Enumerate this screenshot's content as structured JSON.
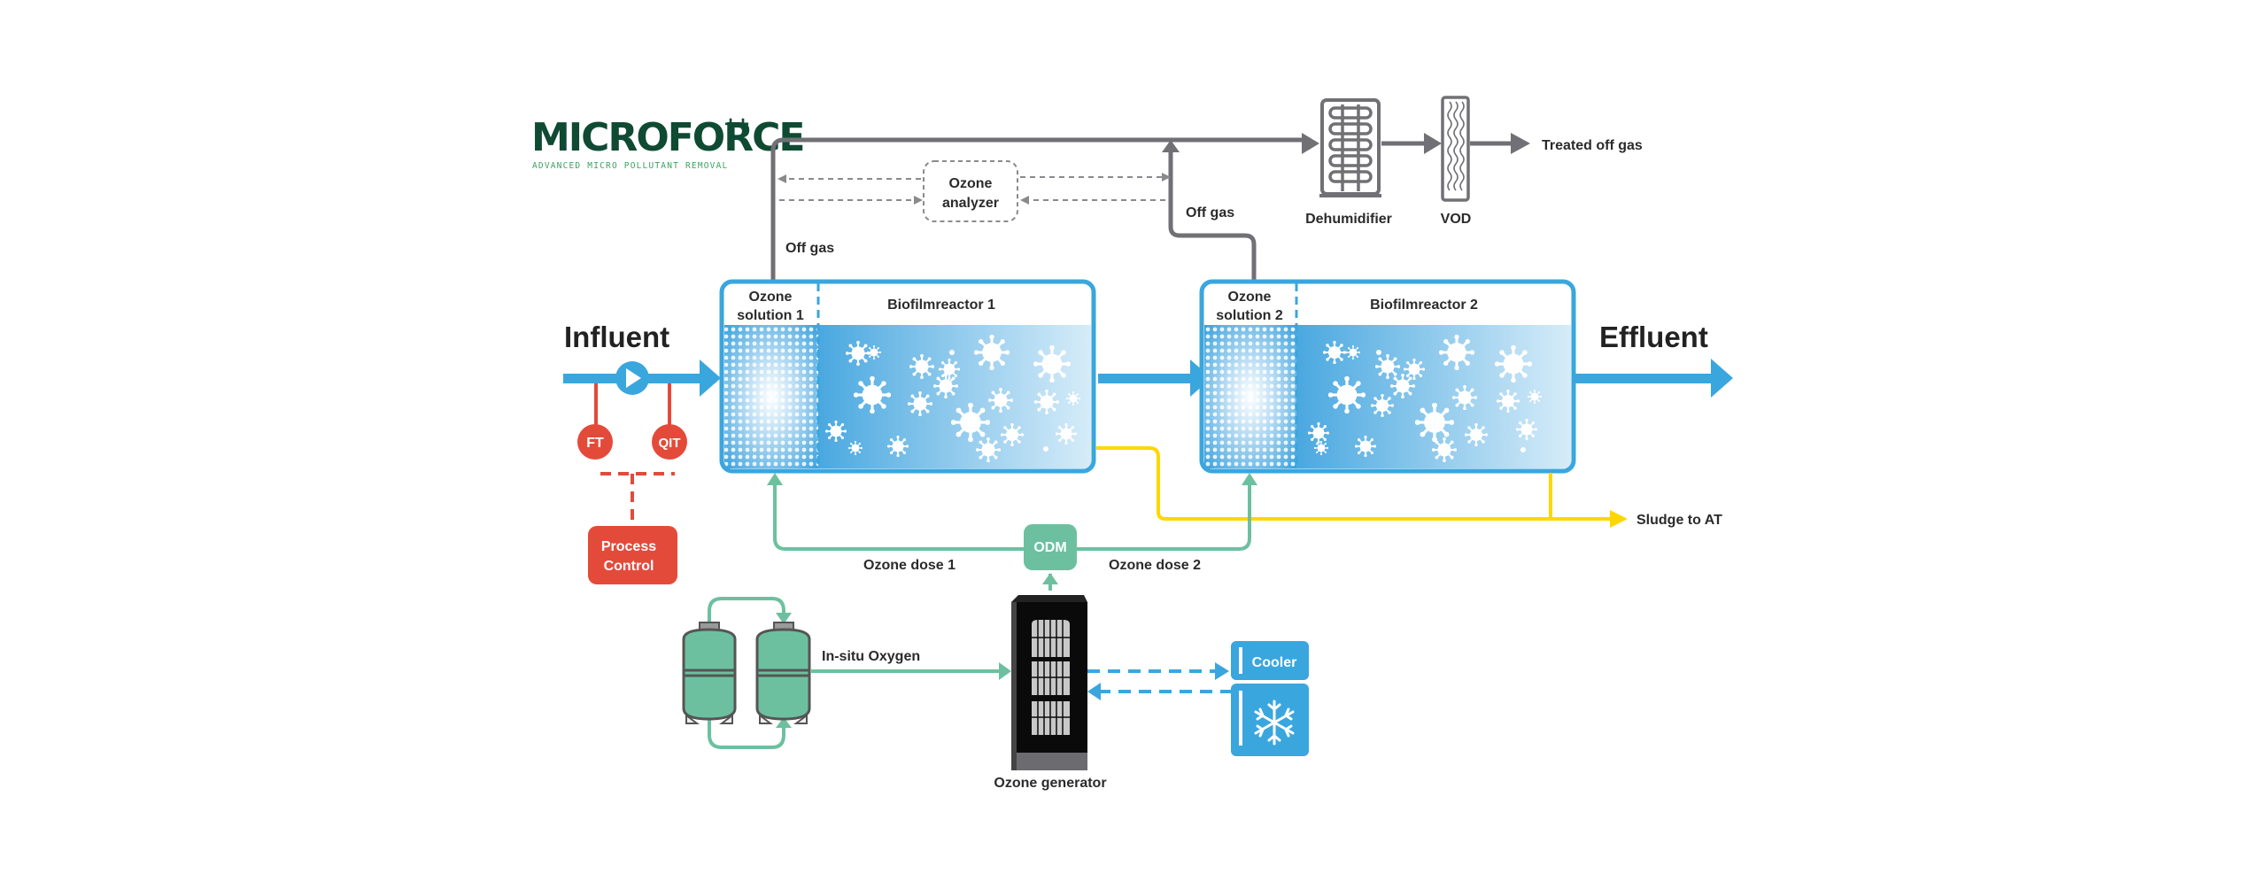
{
  "logo": {
    "title": "MICROFORCE",
    "superscript": "++",
    "subtitle": "ADVANCED MICRO POLLUTANT REMOVAL"
  },
  "colors": {
    "water_blue": "#3aa6de",
    "gas_grey": "#707075",
    "ozone_green": "#6cc0a0",
    "sludge_yellow": "#ffd700",
    "control_red": "#e44a3a",
    "logo_green": "#0f4a33"
  },
  "flows": {
    "influent": "Influent",
    "effluent": "Effluent",
    "treated_off_gas": "Treated off gas",
    "off_gas_1": "Off gas",
    "off_gas_2": "Off gas",
    "sludge": "Sludge to AT",
    "ozone_dose_1": "Ozone dose 1",
    "ozone_dose_2": "Ozone dose 2",
    "in_situ_oxygen": "In-situ Oxygen"
  },
  "equipment": {
    "ozone_analyzer": [
      "Ozone",
      "analyzer"
    ],
    "dehumidifier": "Dehumidifier",
    "vod": "VOD",
    "odm": "ODM",
    "ozone_generator": "Ozone generator",
    "cooler": "Cooler",
    "process_control": [
      "Process",
      "Control"
    ],
    "ft": "FT",
    "qit": "QIT"
  },
  "reactors": [
    {
      "ozone_zone": [
        "Ozone",
        "solution 1"
      ],
      "bio_zone": "Biofilmreactor 1"
    },
    {
      "ozone_zone": [
        "Ozone",
        "solution 2"
      ],
      "bio_zone": "Biofilmreactor 2"
    }
  ]
}
